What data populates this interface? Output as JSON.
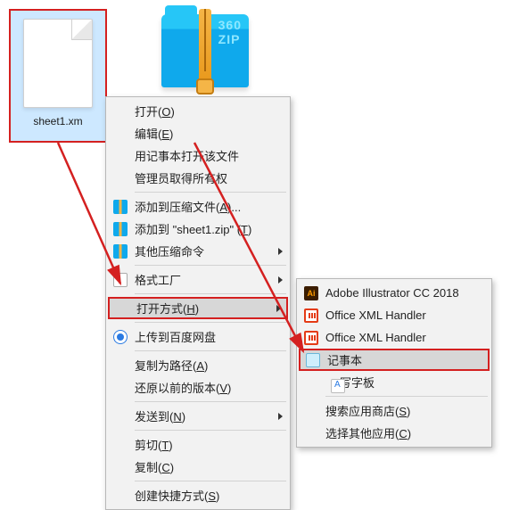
{
  "desktop": {
    "file_label": "sheet1.xm",
    "zip_badge": "360\nZIP"
  },
  "menu1": {
    "open": "打开(",
    "open_u": "O",
    "open_end": ")",
    "edit": "编辑(",
    "edit_u": "E",
    "edit_end": ")",
    "open_notepad": "用记事本打开该文件",
    "admin_own": "管理员取得所有权",
    "add_archive": "添加到压缩文件(",
    "add_archive_u": "A",
    "add_archive_end": ")...",
    "add_to_zip": "添加到 \"sheet1.zip\" (",
    "add_to_zip_u": "T",
    "add_to_zip_end": ")",
    "other_zip": "其他压缩命令",
    "gsgc": "格式工厂",
    "open_with": "打开方式(",
    "open_with_u": "H",
    "open_with_end": ")",
    "baidu": "上传到百度网盘",
    "copy_path": "复制为路径(",
    "copy_path_u": "A",
    "copy_path_end": ")",
    "restore_prev": "还原以前的版本(",
    "restore_prev_u": "V",
    "restore_prev_end": ")",
    "send_to": "发送到(",
    "send_to_u": "N",
    "send_to_end": ")",
    "cut": "剪切(",
    "cut_u": "T",
    "cut_end": ")",
    "copy": "复制(",
    "copy_u": "C",
    "copy_end": ")",
    "shortcut": "创建快捷方式(",
    "shortcut_u": "S",
    "shortcut_end": ")"
  },
  "menu2": {
    "ai": "Adobe Illustrator CC 2018",
    "oxml1": "Office XML Handler",
    "oxml2": "Office XML Handler",
    "notepad": "记事本",
    "wordpad": "写字板",
    "store": "搜索应用商店(",
    "store_u": "S",
    "store_end": ")",
    "choose": "选择其他应用(",
    "choose_u": "C",
    "choose_end": ")"
  }
}
